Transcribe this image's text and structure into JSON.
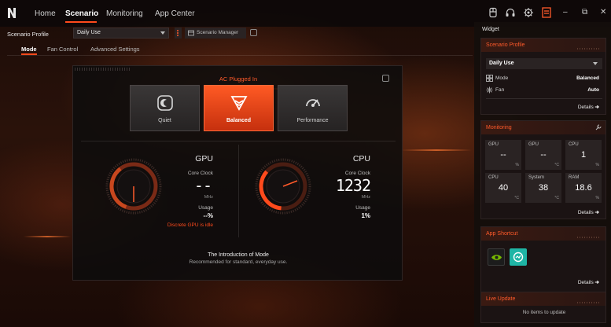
{
  "nav": {
    "tabs": [
      "Home",
      "Scenario",
      "Monitoring",
      "App Center"
    ],
    "active": "Scenario"
  },
  "window_controls": {
    "minimize": "–",
    "restore": "⧉",
    "close": "✕"
  },
  "profile": {
    "label": "Scenario Profile",
    "selected": "Daily Use",
    "manager_label": "Scenario Manager"
  },
  "subtabs": [
    "Mode",
    "Fan Control",
    "Advanced Settings"
  ],
  "panel": {
    "power_status": "AC Plugged In",
    "modes": [
      {
        "label": "Quiet",
        "icon": "quiet-mode-icon",
        "active": false
      },
      {
        "label": "Balanced",
        "icon": "balanced-mode-icon",
        "active": true
      },
      {
        "label": "Performance",
        "icon": "performance-mode-icon",
        "active": false
      }
    ],
    "gpu": {
      "title": "GPU",
      "clock_label": "Core Clock",
      "clock_value": "--",
      "clock_unit": "MHz",
      "usage_label": "Usage",
      "usage_value": "--%",
      "note": "Discrete GPU is idle"
    },
    "cpu": {
      "title": "CPU",
      "clock_label": "Core Clock",
      "clock_value": "1232",
      "clock_unit": "MHz",
      "usage_label": "Usage",
      "usage_value": "1%"
    },
    "intro_title": "The Introduction of Mode",
    "intro_desc": "Recommended for standard, everyday use."
  },
  "widget": {
    "header": "Widget",
    "scenario": {
      "title": "Scenario Profile",
      "selected": "Daily Use",
      "rows": [
        {
          "label": "Mode",
          "value": "Balanced",
          "icon": "mode-grid-icon"
        },
        {
          "label": "Fan",
          "value": "Auto",
          "icon": "fan-icon"
        }
      ],
      "details": "Details"
    },
    "monitoring": {
      "title": "Monitoring",
      "cells": [
        {
          "label": "GPU",
          "value": "--",
          "unit": "%"
        },
        {
          "label": "GPU",
          "value": "--",
          "unit": "°C"
        },
        {
          "label": "CPU",
          "value": "1",
          "unit": "%"
        },
        {
          "label": "CPU",
          "value": "40",
          "unit": "°C"
        },
        {
          "label": "System",
          "value": "38",
          "unit": "°C"
        },
        {
          "label": "RAM",
          "value": "18.6",
          "unit": "%"
        }
      ],
      "details": "Details"
    },
    "shortcut": {
      "title": "App Shortcut",
      "apps": [
        "nvidia-app-icon",
        "teal-app-icon"
      ],
      "details": "Details"
    },
    "live": {
      "title": "Live Update",
      "empty": "No items to update"
    }
  }
}
